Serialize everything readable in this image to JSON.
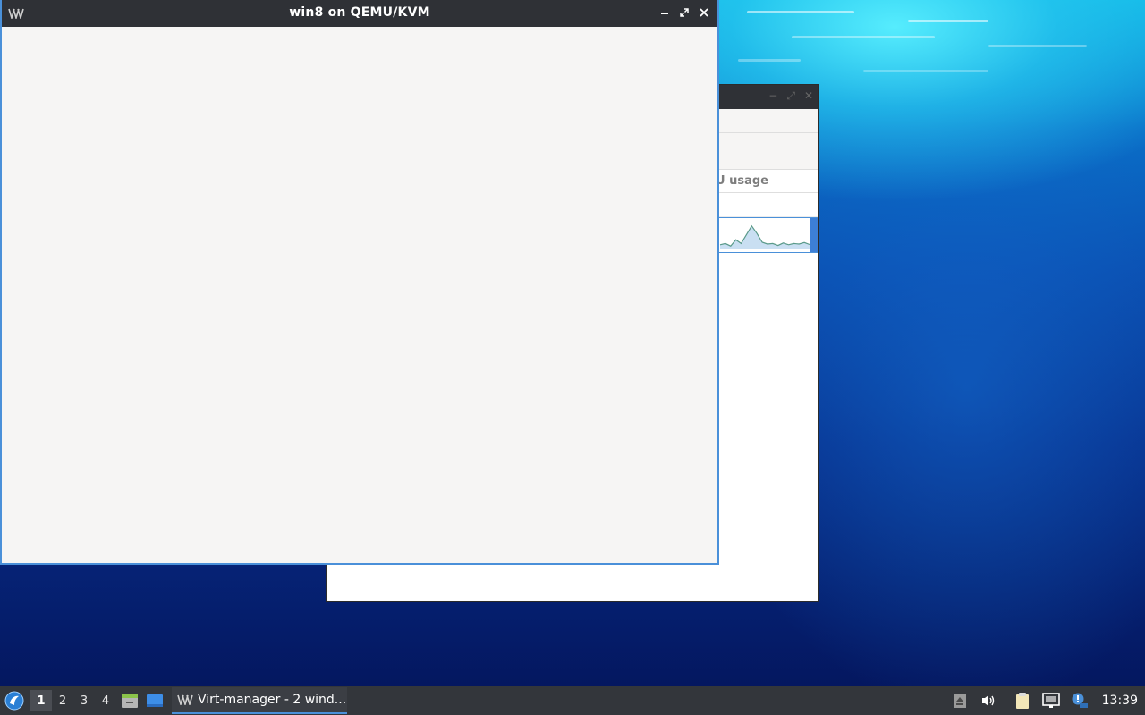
{
  "viewer_window": {
    "title": "win8 on QEMU/KVM"
  },
  "manager_window": {
    "column_header_cpu": "U usage",
    "cpu_sparkline": [
      0.15,
      0.2,
      0.1,
      0.35,
      0.2,
      0.55,
      0.9,
      0.6,
      0.25,
      0.18,
      0.2,
      0.12,
      0.22,
      0.15,
      0.2,
      0.18,
      0.24,
      0.16
    ]
  },
  "taskbar": {
    "workspaces": [
      "1",
      "2",
      "3",
      "4"
    ],
    "active_workspace": "1",
    "task_label": "Virt-manager - 2 wind...",
    "clock": "13:39"
  },
  "colors": {
    "accent": "#4a90d9",
    "titlebar": "#2f3136",
    "taskbar": "#33363b"
  }
}
